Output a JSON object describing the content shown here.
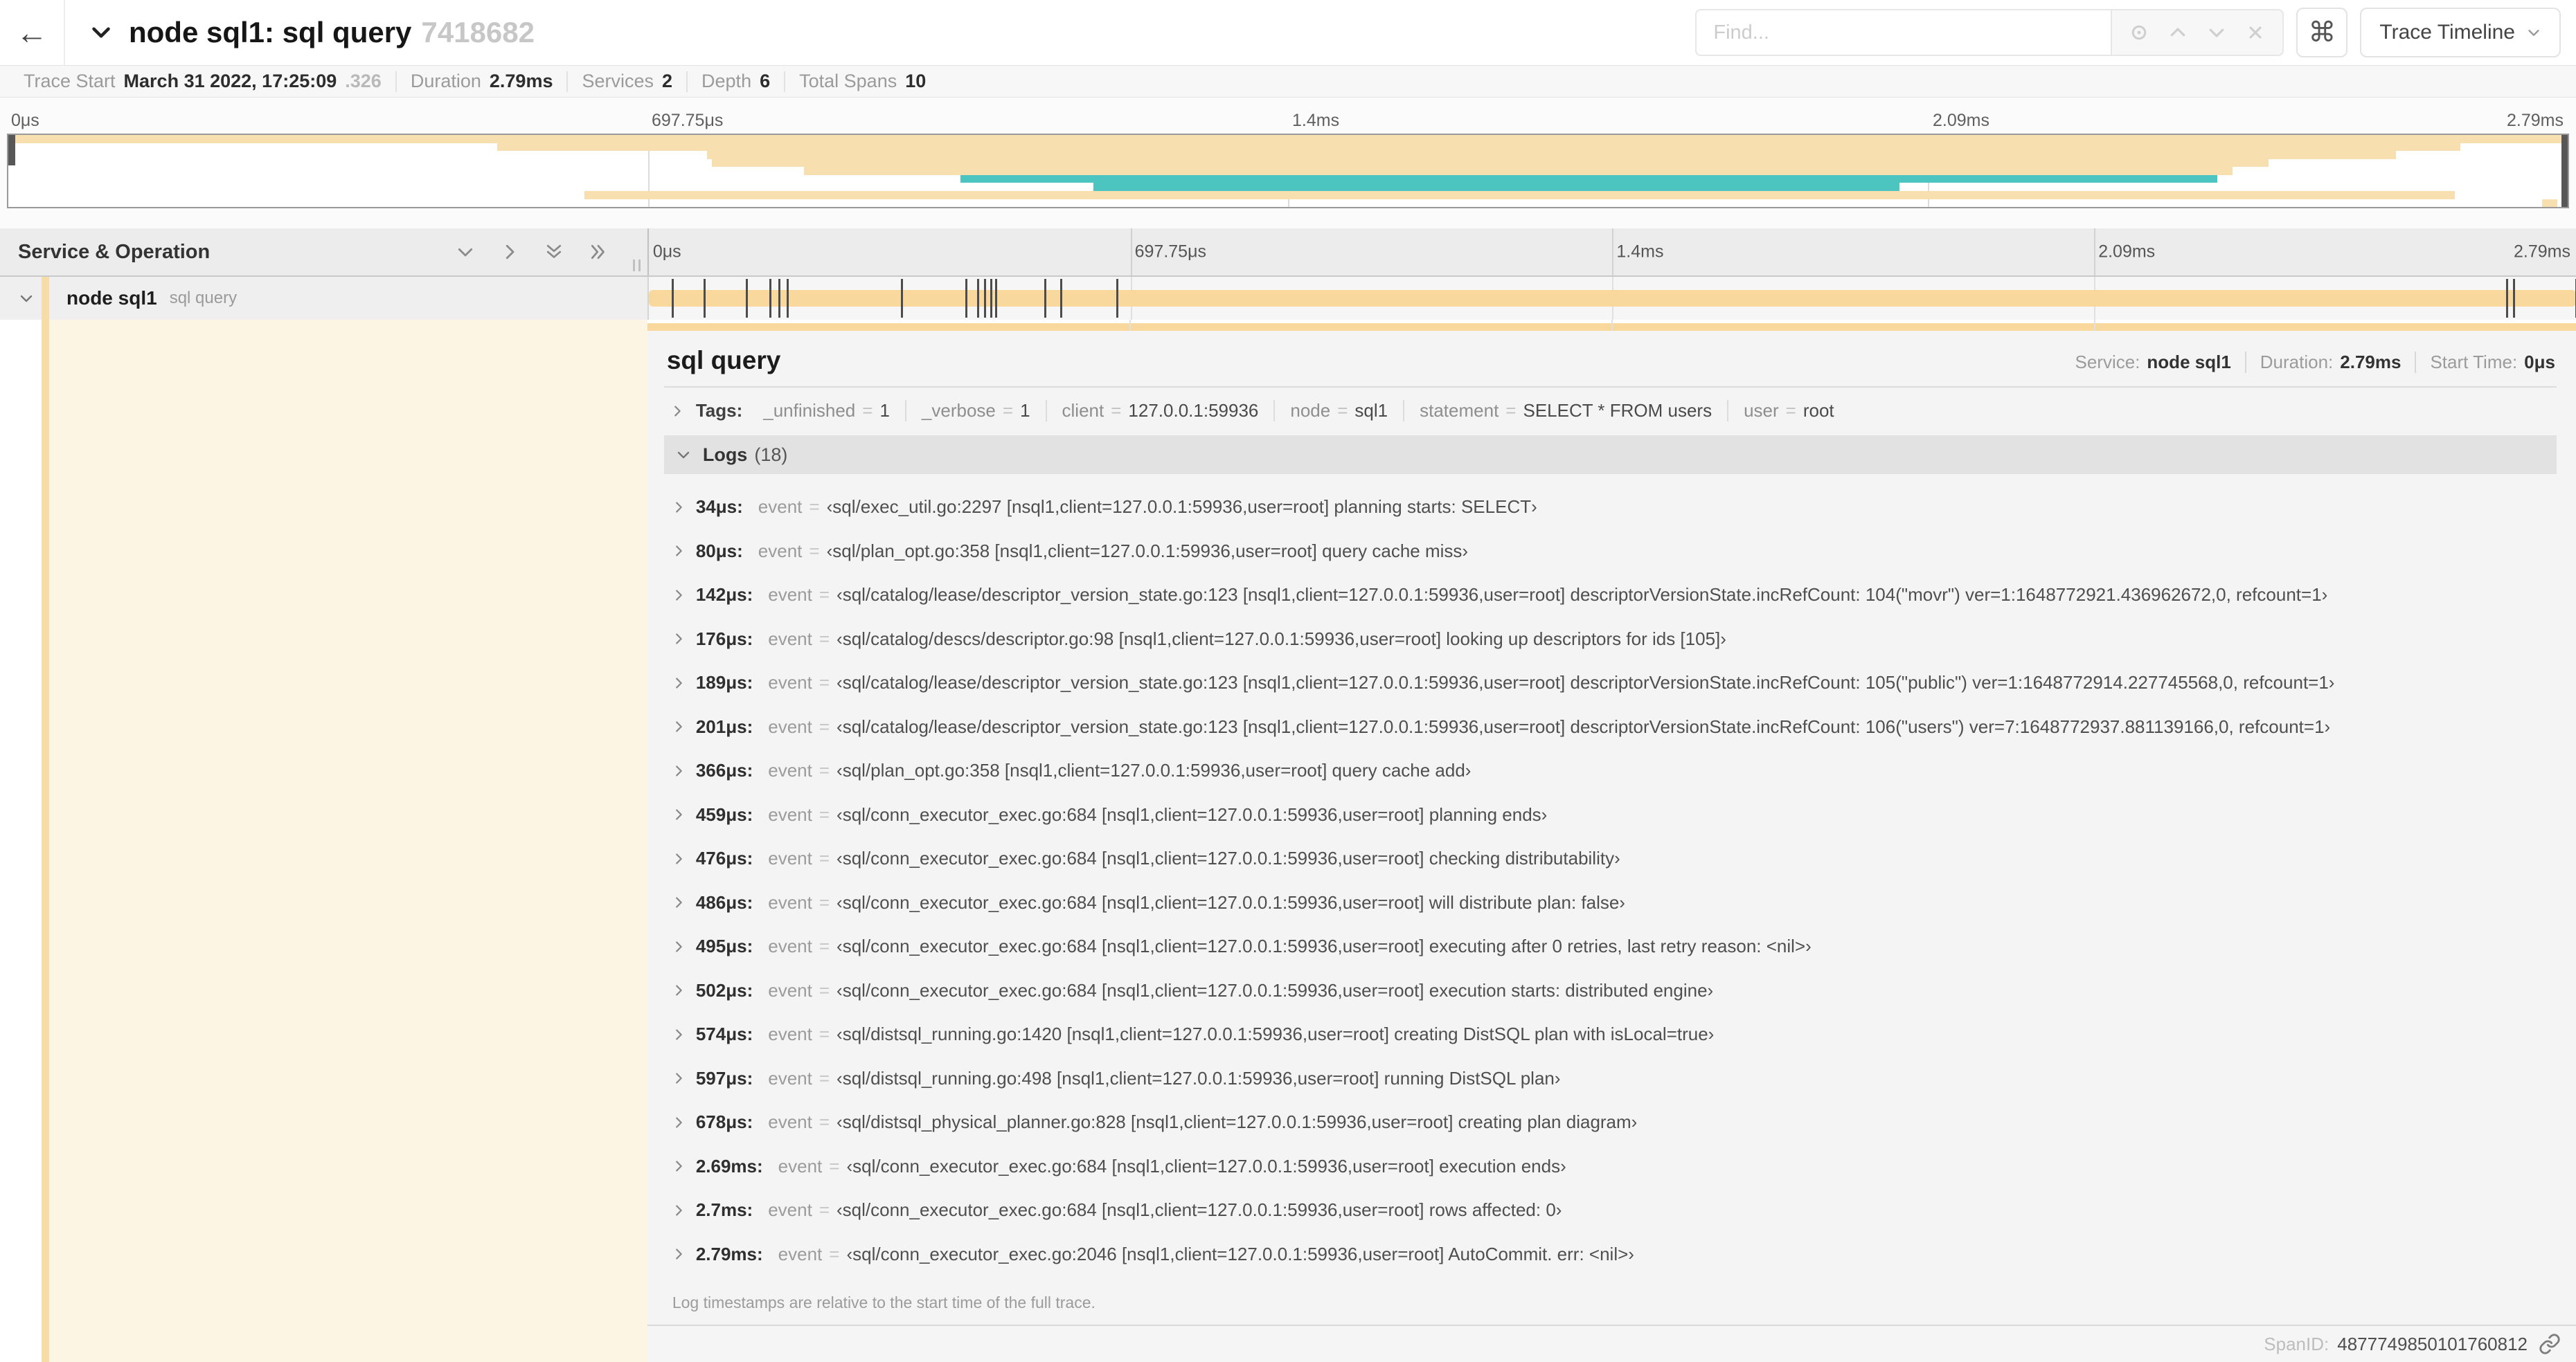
{
  "header": {
    "back_label": "←",
    "title": "node sql1: sql query",
    "trace_id_short": "7418682",
    "find_placeholder": "Find...",
    "shortcut_key": "⌘",
    "view_selector_label": "Trace Timeline"
  },
  "summary": {
    "items": [
      {
        "label": "Trace Start",
        "value": "March 31 2022, 17:25:09",
        "suffix": ".326"
      },
      {
        "label": "Duration",
        "value": "2.79ms"
      },
      {
        "label": "Services",
        "value": "2"
      },
      {
        "label": "Depth",
        "value": "6"
      },
      {
        "label": "Total Spans",
        "value": "10"
      }
    ]
  },
  "timeline": {
    "duration_us": 2790,
    "ticks": [
      {
        "label": "0μs",
        "pct": 0
      },
      {
        "label": "697.75μs",
        "pct": 25
      },
      {
        "label": "1.4ms",
        "pct": 50
      },
      {
        "label": "2.09ms",
        "pct": 75
      },
      {
        "label": "2.79ms",
        "pct": 100
      }
    ],
    "minimap_spans": [
      {
        "start": 0,
        "end": 100,
        "color": "tan"
      },
      {
        "start": 19.1,
        "end": 95.8,
        "color": "tan"
      },
      {
        "start": 27.3,
        "end": 93.3,
        "color": "tan"
      },
      {
        "start": 27.5,
        "end": 88.3,
        "color": "tan"
      },
      {
        "start": 31.1,
        "end": 86.9,
        "color": "tan"
      },
      {
        "start": 37.2,
        "end": 86.3,
        "color": "teal"
      },
      {
        "start": 42.4,
        "end": 73.9,
        "color": "teal"
      },
      {
        "start": 22.5,
        "end": 95.6,
        "color": "tan"
      },
      {
        "start": 99.0,
        "end": 99.6,
        "color": "tan"
      }
    ]
  },
  "tree": {
    "header": "Service & Operation",
    "span": {
      "service": "node sql1",
      "operation": "sql query"
    }
  },
  "detail": {
    "title": "sql query",
    "meta": [
      {
        "label": "Service:",
        "value": "node sql1"
      },
      {
        "label": "Duration:",
        "value": "2.79ms"
      },
      {
        "label": "Start Time:",
        "value": "0μs"
      }
    ],
    "tags_label": "Tags:",
    "tags": [
      {
        "key": "_unfinished",
        "value": "1"
      },
      {
        "key": "_verbose",
        "value": "1"
      },
      {
        "key": "client",
        "value": "127.0.0.1:59936"
      },
      {
        "key": "node",
        "value": "sql1"
      },
      {
        "key": "statement",
        "value": "SELECT * FROM users"
      },
      {
        "key": "user",
        "value": "root"
      }
    ],
    "logs_label": "Logs",
    "logs_count": "(18)",
    "logs": [
      {
        "time": "34μs:",
        "us": 34,
        "key": "event",
        "value": "‹sql/exec_util.go:2297 [nsql1,client=127.0.0.1:59936,user=root] planning starts: SELECT›"
      },
      {
        "time": "80μs:",
        "us": 80,
        "key": "event",
        "value": "‹sql/plan_opt.go:358 [nsql1,client=127.0.0.1:59936,user=root] query cache miss›"
      },
      {
        "time": "142μs:",
        "us": 142,
        "key": "event",
        "value": "‹sql/catalog/lease/descriptor_version_state.go:123 [nsql1,client=127.0.0.1:59936,user=root] descriptorVersionState.incRefCount: 104(\"movr\") ver=1:1648772921.436962672,0, refcount=1›"
      },
      {
        "time": "176μs:",
        "us": 176,
        "key": "event",
        "value": "‹sql/catalog/descs/descriptor.go:98 [nsql1,client=127.0.0.1:59936,user=root] looking up descriptors for ids [105]›"
      },
      {
        "time": "189μs:",
        "us": 189,
        "key": "event",
        "value": "‹sql/catalog/lease/descriptor_version_state.go:123 [nsql1,client=127.0.0.1:59936,user=root] descriptorVersionState.incRefCount: 105(\"public\") ver=1:1648772914.227745568,0, refcount=1›"
      },
      {
        "time": "201μs:",
        "us": 201,
        "key": "event",
        "value": "‹sql/catalog/lease/descriptor_version_state.go:123 [nsql1,client=127.0.0.1:59936,user=root] descriptorVersionState.incRefCount: 106(\"users\") ver=7:1648772937.881139166,0, refcount=1›"
      },
      {
        "time": "366μs:",
        "us": 366,
        "key": "event",
        "value": "‹sql/plan_opt.go:358 [nsql1,client=127.0.0.1:59936,user=root] query cache add›"
      },
      {
        "time": "459μs:",
        "us": 459,
        "key": "event",
        "value": "‹sql/conn_executor_exec.go:684 [nsql1,client=127.0.0.1:59936,user=root] planning ends›"
      },
      {
        "time": "476μs:",
        "us": 476,
        "key": "event",
        "value": "‹sql/conn_executor_exec.go:684 [nsql1,client=127.0.0.1:59936,user=root] checking distributability›"
      },
      {
        "time": "486μs:",
        "us": 486,
        "key": "event",
        "value": "‹sql/conn_executor_exec.go:684 [nsql1,client=127.0.0.1:59936,user=root] will distribute plan: false›"
      },
      {
        "time": "495μs:",
        "us": 495,
        "key": "event",
        "value": "‹sql/conn_executor_exec.go:684 [nsql1,client=127.0.0.1:59936,user=root] executing after 0 retries, last retry reason: <nil>›"
      },
      {
        "time": "502μs:",
        "us": 502,
        "key": "event",
        "value": "‹sql/conn_executor_exec.go:684 [nsql1,client=127.0.0.1:59936,user=root] execution starts: distributed engine›"
      },
      {
        "time": "574μs:",
        "us": 574,
        "key": "event",
        "value": "‹sql/distsql_running.go:1420 [nsql1,client=127.0.0.1:59936,user=root] creating DistSQL plan with isLocal=true›"
      },
      {
        "time": "597μs:",
        "us": 597,
        "key": "event",
        "value": "‹sql/distsql_running.go:498 [nsql1,client=127.0.0.1:59936,user=root] running DistSQL plan›"
      },
      {
        "time": "678μs:",
        "us": 678,
        "key": "event",
        "value": "‹sql/distsql_physical_planner.go:828 [nsql1,client=127.0.0.1:59936,user=root] creating plan diagram›"
      },
      {
        "time": "2.69ms:",
        "us": 2690,
        "key": "event",
        "value": "‹sql/conn_executor_exec.go:684 [nsql1,client=127.0.0.1:59936,user=root] execution ends›"
      },
      {
        "time": "2.7ms:",
        "us": 2700,
        "key": "event",
        "value": "‹sql/conn_executor_exec.go:684 [nsql1,client=127.0.0.1:59936,user=root] rows affected: 0›"
      },
      {
        "time": "2.79ms:",
        "us": 2790,
        "key": "event",
        "value": "‹sql/conn_executor_exec.go:2046 [nsql1,client=127.0.0.1:59936,user=root] AutoCommit. err: <nil>›"
      }
    ],
    "footer_note": "Log timestamps are relative to the start time of the full trace.",
    "span_id_label": "SpanID:",
    "span_id": "4877749850101760812"
  },
  "colors": {
    "span_tan": "#f8d89c",
    "minimap_tan": "#f8dfb0",
    "minimap_teal": "#4cc4bf",
    "guide_tan": "#f6dda8",
    "detail_cream": "#fdf5e4"
  }
}
